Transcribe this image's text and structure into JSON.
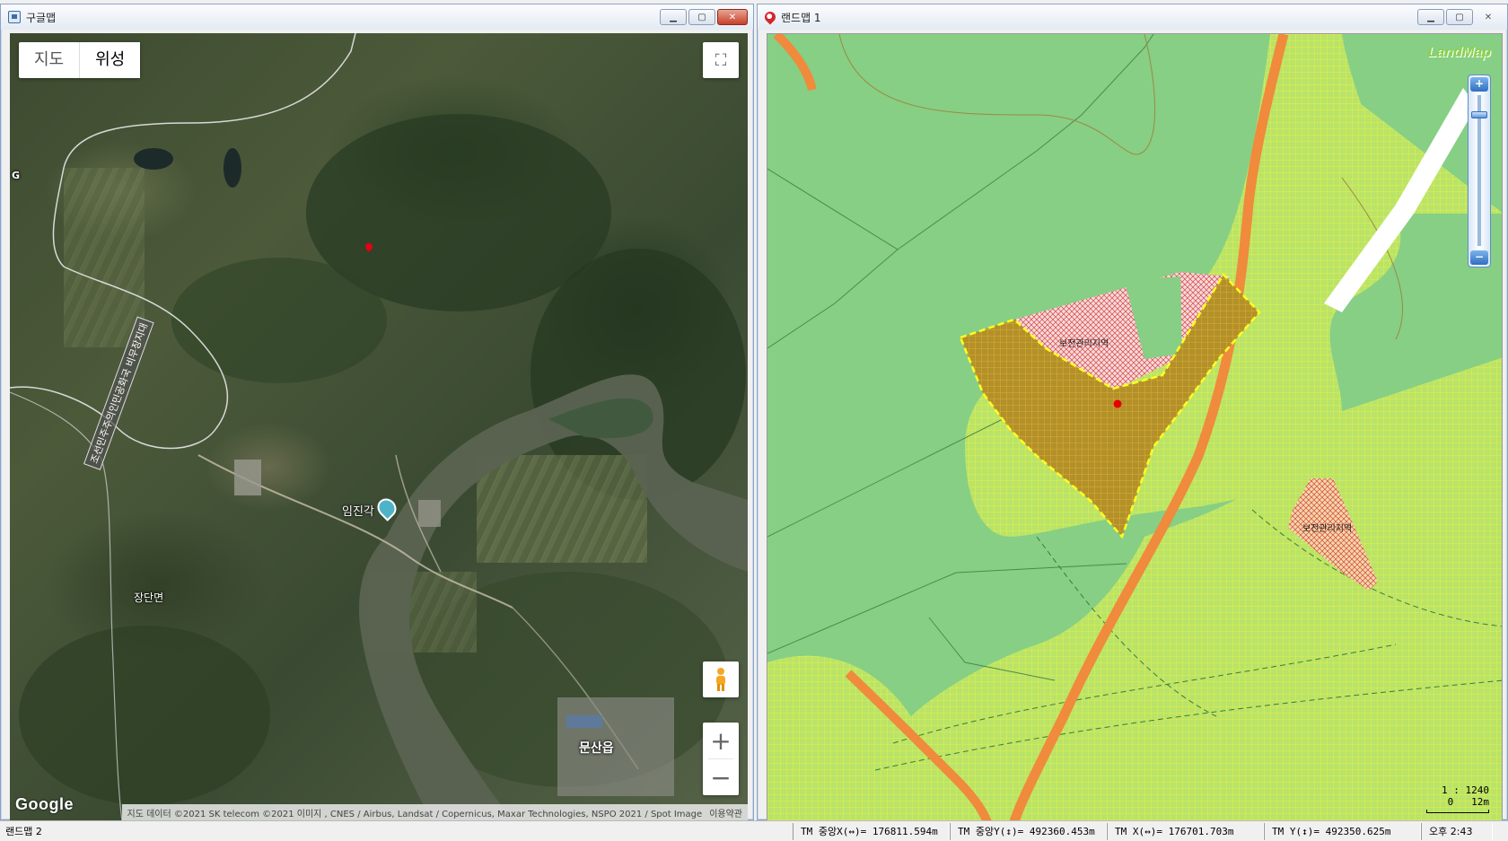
{
  "google_window": {
    "title": "구글맵",
    "toggle": {
      "map": "지도",
      "satellite": "위성"
    },
    "labels": {
      "imjingak": "임진각",
      "jangdan": "장단면",
      "munsan": "문산읍",
      "g_mark": "G"
    },
    "road_label": "조선민주주의인민공화국 비무장지대",
    "logo": "Google",
    "attribution": "지도 데이터 ©2021 SK telecom ©2021 이미지 , CNES / Airbus, Landsat / Copernicus, Maxar Technologies, NSPO 2021 / Spot Image",
    "terms": "이용약관",
    "zoom_in": "+",
    "zoom_out": "−"
  },
  "land_window": {
    "title": "랜드맵 1",
    "logo": "LandMap",
    "zones": [
      "보전관리지역",
      "보전관리지역"
    ],
    "scale_text": "1 : 1240",
    "scale_bar": "0   12m",
    "zoom_in": "+",
    "zoom_out": "−"
  },
  "statusbar": {
    "main": "랜드맵 2",
    "tm_center_x": "TM 중앙X(↔)= 176811.594m",
    "tm_center_y": "TM 중앙Y(↕)= 492360.453m",
    "tm_x": "TM X(↔)= 176701.703m",
    "tm_y": "TM Y(↕)= 492350.625m",
    "time": "오후 2:43"
  }
}
